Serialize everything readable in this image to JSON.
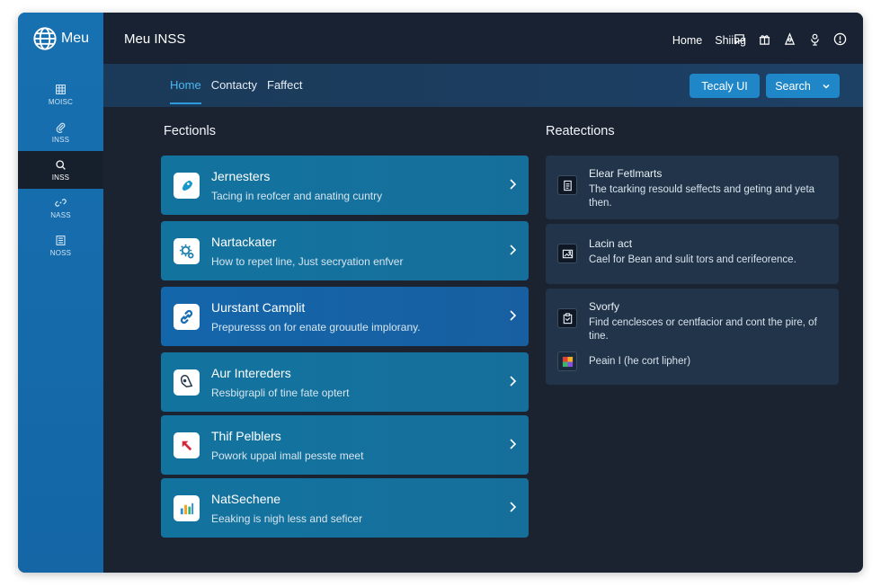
{
  "logo": {
    "text": "Meu",
    "icon": "globe-icon"
  },
  "header": {
    "title": "Meu INSS",
    "links": [
      "Home",
      "Shiing"
    ],
    "icons": [
      "chat-icon",
      "gift-icon",
      "user-icon",
      "mic-icon",
      "info-icon"
    ]
  },
  "sidebar": {
    "items": [
      {
        "label": "MOISC",
        "icon": "grid-icon"
      },
      {
        "label": "INSS",
        "icon": "paperclip-icon"
      },
      {
        "label": "INSS",
        "icon": "search-icon"
      },
      {
        "label": "NASS",
        "icon": "link-icon"
      },
      {
        "label": "NOSS",
        "icon": "list-icon"
      }
    ],
    "active_index": 2
  },
  "toolbar": {
    "tabs": [
      "Home",
      "Contacty",
      "Faffect"
    ],
    "active_tab": 0,
    "layout_button": "Tecaly UI",
    "search_button": "Search"
  },
  "main": {
    "section_title": "Fectionls",
    "cards": [
      {
        "title": "Jernesters",
        "subtitle": "Tacing in reofcer and anating cuntry",
        "icon": "rocket-icon"
      },
      {
        "title": "Nartackater",
        "subtitle": "How to repet line, Just secryation enfver",
        "icon": "settings-icon"
      },
      {
        "title": "Uurstant Camplit",
        "subtitle": "Prepuresss on for enate grouutle implorany.",
        "icon": "link-icon"
      },
      {
        "title": "Aur Intereders",
        "subtitle": "Resbigrapli of tine fate optert",
        "icon": "tag-icon"
      },
      {
        "title": "Thif Pelblers",
        "subtitle": "Powork uppal imall pesste meet",
        "icon": "arrow-icon"
      },
      {
        "title": "NatSechene",
        "subtitle": "Eeaking is nigh less and seficer",
        "icon": "bar-chart-icon"
      }
    ]
  },
  "right": {
    "section_title": "Reatections",
    "panels": [
      {
        "title": "Elear Fetlmarts",
        "text": "The tcarking resould seffects and geting and yeta then.",
        "icon": "document-icon"
      },
      {
        "title": "Lacin act",
        "text": "Cael for Bean and sulit tors and cerifeorence.",
        "icon": "image-icon"
      },
      {
        "title": "Svorfy",
        "text": "Find cenclesces or centfacior and cont the pire, of tine.",
        "icon": "clipboard-icon",
        "extra": "Peain I (he cort lipher)",
        "extra_icon": "palette-icon"
      }
    ]
  },
  "colors": {
    "sidebar": "#1770b0",
    "header": "#182232",
    "card": "#13739f",
    "accent": "#1f86c7",
    "active_tab": "#4bb6f2"
  }
}
